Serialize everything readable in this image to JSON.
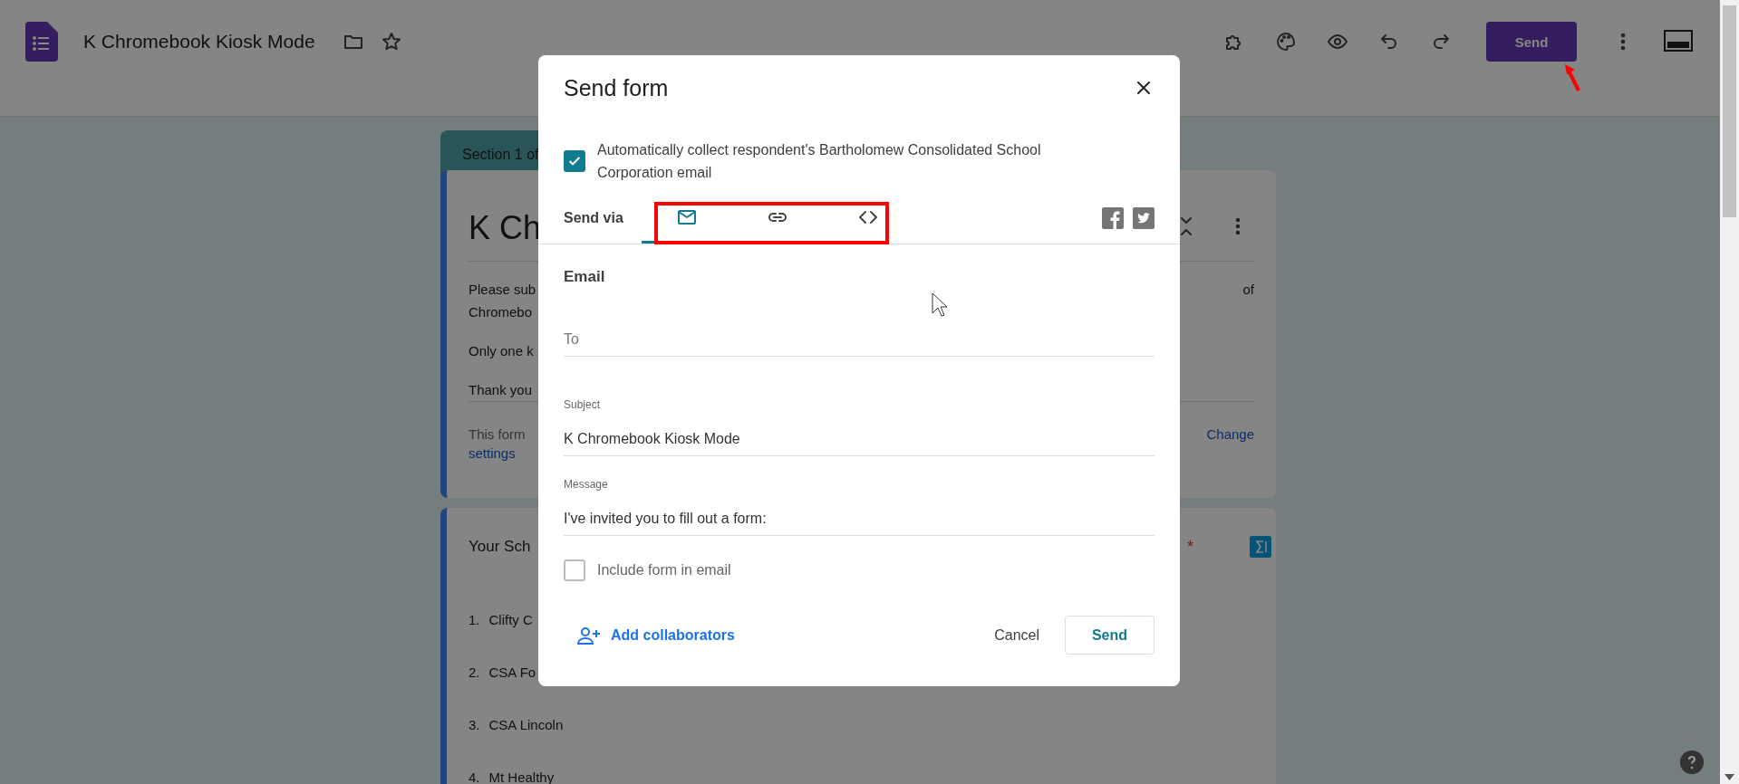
{
  "app_bar": {
    "title": "K Chromebook Kiosk Mode",
    "send_button": "Send"
  },
  "header_card": {
    "section_label": "Section 1 of",
    "title": "K Ch",
    "paragraphs": [
      {
        "lines": [
          {
            "text": "Please sub",
            "right": "of"
          },
          {
            "text": "Chromebo"
          }
        ]
      },
      {
        "lines": [
          {
            "text": "Only one k"
          }
        ]
      },
      {
        "lines": [
          {
            "text": "Thank you"
          }
        ]
      }
    ],
    "note": "This form",
    "note_right_link": "Change",
    "note_link": "settings"
  },
  "question_card": {
    "title": "Your Sch",
    "required_mark": "*",
    "options": [
      {
        "number": "1.",
        "label": "Clifty C"
      },
      {
        "number": "2.",
        "label": "CSA Fo"
      },
      {
        "number": "3.",
        "label": "CSA Lincoln"
      },
      {
        "number": "4.",
        "label": "Mt Healthy"
      }
    ]
  },
  "dialog": {
    "title": "Send form",
    "auto_collect": {
      "label": "Automatically collect respondent's Bartholomew Consolidated School Corporation email",
      "checked": true
    },
    "send_via_label": "Send via",
    "tabs": [
      {
        "kind": "email",
        "selected": true
      },
      {
        "kind": "link",
        "selected": false
      },
      {
        "kind": "embed",
        "selected": false
      }
    ],
    "share": [
      {
        "kind": "facebook"
      },
      {
        "kind": "twitter"
      }
    ],
    "section_title": "Email",
    "to": {
      "placeholder": "To"
    },
    "subject": {
      "label": "Subject",
      "value": "K Chromebook Kiosk Mode"
    },
    "message": {
      "label": "Message",
      "value": "I've invited you to fill out a form:"
    },
    "include_form": {
      "label": "Include form in email",
      "checked": false
    },
    "add_collaborators": "Add collaborators",
    "cancel": "Cancel",
    "send": "Send"
  }
}
